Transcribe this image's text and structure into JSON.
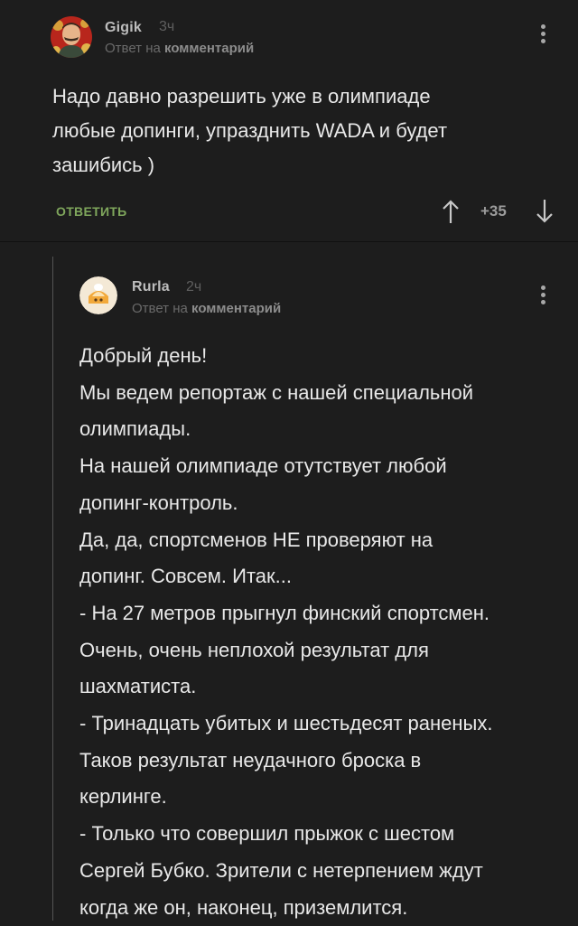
{
  "comment": {
    "author": "Gigik",
    "time": "3ч",
    "reply_prefix": "Ответ на",
    "reply_target": "комментарий",
    "text": "Надо давно разрешить уже в олимпиаде\nлюбые допинги, упразднить WADA и будет\nзашибись )",
    "reply_label": "ОТВЕТИТЬ",
    "score": "+35"
  },
  "reply": {
    "author": "Rurla",
    "time": "2ч",
    "reply_prefix": "Ответ на",
    "reply_target": "комментарий",
    "lines": [
      "Добрый день!",
      "Мы ведем репортаж с нашей специальной",
      "олимпиады.",
      "На нашей олимпиаде отутствует любой",
      "допинг-контроль.",
      "Да, да, спортсменов НЕ проверяют на",
      "допинг. Совсем. Итак...",
      "- На 27 метров прыгнул финский спортсмен.",
      "Очень, очень неплохой результат для",
      "шахматиста.",
      "- Тринадцать убитых и шестьдесят раненых.",
      "Таков результат неудачного броска в",
      "керлинге.",
      "- Только что совершил прыжок с шестом",
      "Сергей Бубко. Зрители с нетерпением ждут",
      "когда же он, наконец, приземлится."
    ]
  },
  "icons": {
    "menu": "kebab-vertical-icon",
    "upvote": "arrow-up-icon",
    "downvote": "arrow-down-icon"
  },
  "colors": {
    "background": "#1d1d1d",
    "reply_accent": "#7fa65c",
    "text": "#e8e8e8"
  }
}
